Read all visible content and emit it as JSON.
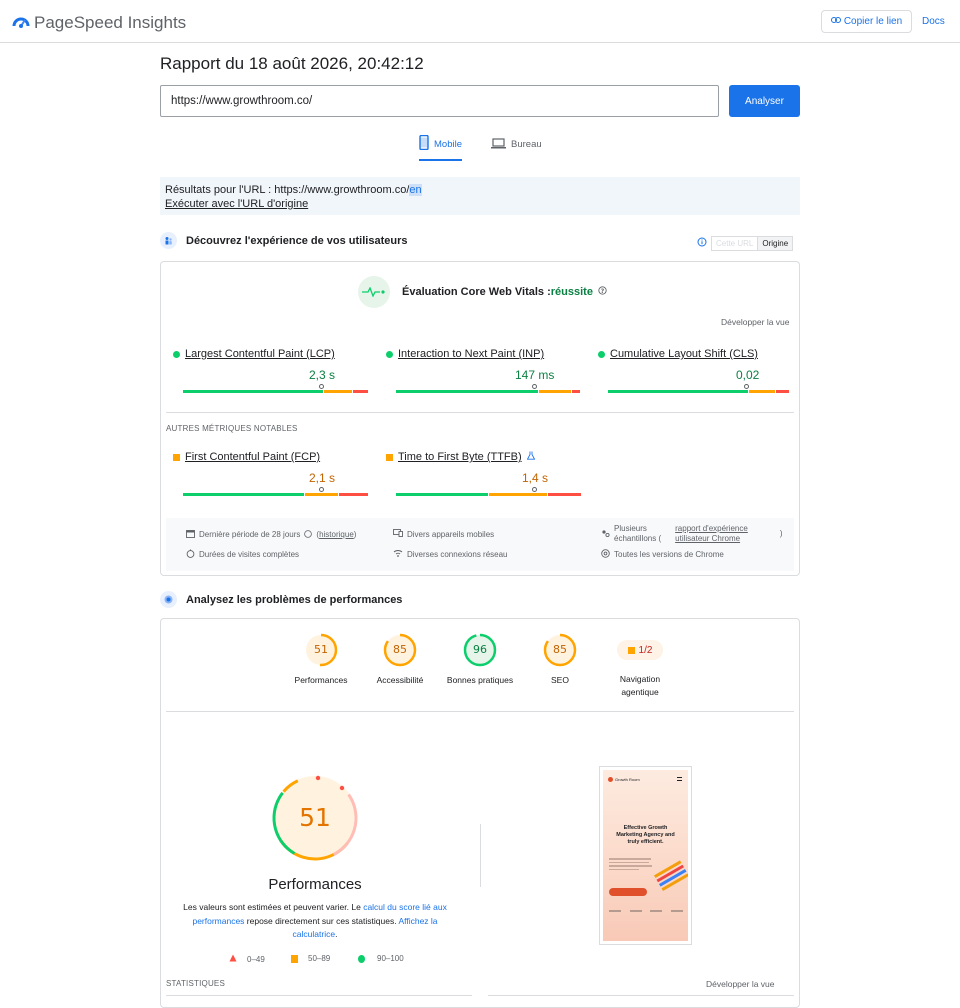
{
  "header": {
    "app_name": "PageSpeed Insights",
    "copy_link_label": "Copier le lien",
    "docs_label": "Docs"
  },
  "report": {
    "title": "Rapport du 18 août 2026, 20:42:12",
    "url_value": "https://www.growthroom.co/",
    "analyze_label": "Analyser"
  },
  "tabs": [
    {
      "label": "Mobile",
      "active": true
    },
    {
      "label": "Bureau",
      "active": false
    }
  ],
  "results_notice": {
    "prefix": "Résultats pour l'URL : https://www.growthroom.co/",
    "suffix": "en",
    "origin_link": "Exécuter avec l'URL d'origine"
  },
  "field_section": {
    "title": "Découvrez l'expérience de vos utilisateurs",
    "toggle_options": [
      "Cette URL",
      "Origine"
    ],
    "selected": "Origine",
    "cwv_title": "Évaluation Core Web Vitals :",
    "cwv_result": "réussite",
    "expand_label": "Développer la vue",
    "metrics": [
      {
        "name": "Largest Contentful Paint (LCP)",
        "value": "2,3 s",
        "status": "good"
      },
      {
        "name": "Interaction to Next Paint (INP)",
        "value": "147 ms",
        "status": "good"
      },
      {
        "name": "Cumulative Layout Shift (CLS)",
        "value": "0,02",
        "status": "good"
      }
    ],
    "other_label": "AUTRES MÉTRIQUES NOTABLES",
    "other_metrics": [
      {
        "name": "First Contentful Paint (FCP)",
        "value": "2,1 s",
        "status": "average"
      },
      {
        "name": "Time to First Byte (TTFB)",
        "value": "1,4 s",
        "status": "average"
      }
    ],
    "meta": {
      "period": "Dernière période de 28 jours",
      "period_link": "historique",
      "devices": "Divers appareils mobiles",
      "samples_1": "Plusieurs",
      "samples_2": "échantillons (",
      "crux_link_1": "rapport d'expérience",
      "crux_link_2": "utilisateur Chrome",
      "close_paren": ")",
      "durations": "Durées de visites complètes",
      "connections": "Diverses connexions réseau",
      "chrome_versions": "Toutes les versions de Chrome"
    }
  },
  "lab_section": {
    "title": "Analysez les problèmes de performances",
    "scores": [
      {
        "label": "Performances",
        "value": "51",
        "fraction": 0.51,
        "color": "#e37400"
      },
      {
        "label": "Accessibilité",
        "value": "85",
        "fraction": 0.85,
        "color": "#e37400"
      },
      {
        "label": "Bonnes pratiques",
        "value": "96",
        "fraction": 0.96,
        "color": "#0b8043"
      },
      {
        "label": "SEO",
        "value": "85",
        "fraction": 0.85,
        "color": "#e37400"
      }
    ],
    "agentic": {
      "label": "Navigation agentique",
      "value": "1/2"
    },
    "big_score": {
      "value": "51",
      "label": "Performances"
    },
    "desc_1": "Les valeurs sont estimées et peuvent varier. Le ",
    "desc_link_1": "calcul du score lié aux performances",
    "desc_2": " repose directement sur ces statistiques. ",
    "desc_link_2": "Affichez la calculatrice",
    "desc_3": ".",
    "legend": [
      "0–49",
      "50–89",
      "90–100"
    ],
    "stats_label": "STATISTIQUES",
    "expand_label": "Développer la vue",
    "screenshot": {
      "brand": "Growth Room",
      "headline_1": "Effective Growth",
      "headline_2": "Marketing Agency and",
      "headline_3": "truly efficient."
    }
  },
  "colors": {
    "accent": "#1a73e8",
    "good": "#0cce6b",
    "average": "#ffa400",
    "poor": "#ff4e42"
  }
}
